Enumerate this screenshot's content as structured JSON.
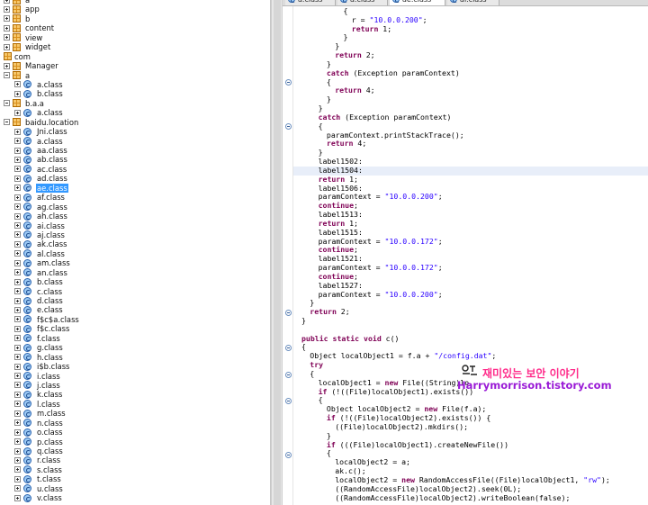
{
  "tree": {
    "items": [
      {
        "label": "a",
        "depth": 0,
        "kind": "pkg",
        "exp": "plus"
      },
      {
        "label": "app",
        "depth": 0,
        "kind": "pkg",
        "exp": "plus"
      },
      {
        "label": "b",
        "depth": 0,
        "kind": "pkg",
        "exp": "plus"
      },
      {
        "label": "content",
        "depth": 0,
        "kind": "pkg",
        "exp": "plus"
      },
      {
        "label": "view",
        "depth": 0,
        "kind": "pkg",
        "exp": "plus"
      },
      {
        "label": "widget",
        "depth": 0,
        "kind": "pkg",
        "exp": "plus"
      },
      {
        "label": "com",
        "depth": -1,
        "kind": "pkg",
        "exp": "none"
      },
      {
        "label": "Manager",
        "depth": 0,
        "kind": "pkg",
        "exp": "plus"
      },
      {
        "label": "a",
        "depth": 0,
        "kind": "pkg",
        "exp": "minus"
      },
      {
        "label": "a.class",
        "depth": 1,
        "kind": "cls",
        "exp": "plus"
      },
      {
        "label": "b.class",
        "depth": 1,
        "kind": "cls",
        "exp": "plus"
      },
      {
        "label": "b.a.a",
        "depth": 0,
        "kind": "pkg",
        "exp": "minus"
      },
      {
        "label": "a.class",
        "depth": 1,
        "kind": "cls",
        "exp": "plus"
      },
      {
        "label": "baidu.location",
        "depth": 0,
        "kind": "pkg",
        "exp": "minus"
      },
      {
        "label": "Jni.class",
        "depth": 1,
        "kind": "cls",
        "exp": "plus"
      },
      {
        "label": "a.class",
        "depth": 1,
        "kind": "cls",
        "exp": "plus"
      },
      {
        "label": "aa.class",
        "depth": 1,
        "kind": "cls",
        "exp": "plus"
      },
      {
        "label": "ab.class",
        "depth": 1,
        "kind": "cls",
        "exp": "plus"
      },
      {
        "label": "ac.class",
        "depth": 1,
        "kind": "cls",
        "exp": "plus"
      },
      {
        "label": "ad.class",
        "depth": 1,
        "kind": "cls",
        "exp": "plus"
      },
      {
        "label": "ae.class",
        "depth": 1,
        "kind": "cls",
        "exp": "plus",
        "selected": true
      },
      {
        "label": "af.class",
        "depth": 1,
        "kind": "cls",
        "exp": "plus"
      },
      {
        "label": "ag.class",
        "depth": 1,
        "kind": "cls",
        "exp": "plus"
      },
      {
        "label": "ah.class",
        "depth": 1,
        "kind": "cls",
        "exp": "plus"
      },
      {
        "label": "ai.class",
        "depth": 1,
        "kind": "cls",
        "exp": "plus"
      },
      {
        "label": "aj.class",
        "depth": 1,
        "kind": "cls",
        "exp": "plus"
      },
      {
        "label": "ak.class",
        "depth": 1,
        "kind": "cls",
        "exp": "plus"
      },
      {
        "label": "al.class",
        "depth": 1,
        "kind": "cls",
        "exp": "plus"
      },
      {
        "label": "am.class",
        "depth": 1,
        "kind": "cls",
        "exp": "plus"
      },
      {
        "label": "an.class",
        "depth": 1,
        "kind": "cls",
        "exp": "plus"
      },
      {
        "label": "b.class",
        "depth": 1,
        "kind": "cls",
        "exp": "plus"
      },
      {
        "label": "c.class",
        "depth": 1,
        "kind": "cls",
        "exp": "plus"
      },
      {
        "label": "d.class",
        "depth": 1,
        "kind": "cls",
        "exp": "plus"
      },
      {
        "label": "e.class",
        "depth": 1,
        "kind": "cls",
        "exp": "plus"
      },
      {
        "label": "f$c$a.class",
        "depth": 1,
        "kind": "cls",
        "exp": "plus"
      },
      {
        "label": "f$c.class",
        "depth": 1,
        "kind": "cls",
        "exp": "plus"
      },
      {
        "label": "f.class",
        "depth": 1,
        "kind": "cls",
        "exp": "plus"
      },
      {
        "label": "g.class",
        "depth": 1,
        "kind": "cls",
        "exp": "plus"
      },
      {
        "label": "h.class",
        "depth": 1,
        "kind": "cls",
        "exp": "plus"
      },
      {
        "label": "i$b.class",
        "depth": 1,
        "kind": "cls",
        "exp": "plus"
      },
      {
        "label": "i.class",
        "depth": 1,
        "kind": "cls",
        "exp": "plus"
      },
      {
        "label": "j.class",
        "depth": 1,
        "kind": "cls",
        "exp": "plus"
      },
      {
        "label": "k.class",
        "depth": 1,
        "kind": "cls",
        "exp": "plus"
      },
      {
        "label": "l.class",
        "depth": 1,
        "kind": "cls",
        "exp": "plus"
      },
      {
        "label": "m.class",
        "depth": 1,
        "kind": "cls",
        "exp": "plus"
      },
      {
        "label": "n.class",
        "depth": 1,
        "kind": "cls",
        "exp": "plus"
      },
      {
        "label": "o.class",
        "depth": 1,
        "kind": "cls",
        "exp": "plus"
      },
      {
        "label": "p.class",
        "depth": 1,
        "kind": "cls",
        "exp": "plus"
      },
      {
        "label": "q.class",
        "depth": 1,
        "kind": "cls",
        "exp": "plus"
      },
      {
        "label": "r.class",
        "depth": 1,
        "kind": "cls",
        "exp": "plus"
      },
      {
        "label": "s.class",
        "depth": 1,
        "kind": "cls",
        "exp": "plus"
      },
      {
        "label": "t.class",
        "depth": 1,
        "kind": "cls",
        "exp": "plus"
      },
      {
        "label": "u.class",
        "depth": 1,
        "kind": "cls",
        "exp": "plus"
      },
      {
        "label": "v.class",
        "depth": 1,
        "kind": "cls",
        "exp": "plus"
      }
    ]
  },
  "editor": {
    "tabs": [
      {
        "label": "a.class",
        "active": false
      },
      {
        "label": "a.class",
        "active": false
      },
      {
        "label": "ae.class",
        "active": true
      },
      {
        "label": "af.class",
        "active": false
      }
    ],
    "highlight_line": 18,
    "lines": [
      {
        "indent": 5,
        "text": "{"
      },
      {
        "indent": 6,
        "text": "r = \"10.0.0.200\";"
      },
      {
        "indent": 6,
        "text": "return 1;"
      },
      {
        "indent": 5,
        "text": "}"
      },
      {
        "indent": 4,
        "text": "}"
      },
      {
        "indent": 4,
        "text": "return 2;"
      },
      {
        "indent": 3,
        "text": "}"
      },
      {
        "indent": 3,
        "text": "catch (Exception paramContext)"
      },
      {
        "indent": 3,
        "text": "{"
      },
      {
        "indent": 4,
        "text": "return 4;"
      },
      {
        "indent": 3,
        "text": "}"
      },
      {
        "indent": 2,
        "text": "}"
      },
      {
        "indent": 2,
        "text": "catch (Exception paramContext)"
      },
      {
        "indent": 2,
        "text": "{"
      },
      {
        "indent": 3,
        "text": "paramContext.printStackTrace();"
      },
      {
        "indent": 3,
        "text": "return 4;"
      },
      {
        "indent": 2,
        "text": "}"
      },
      {
        "indent": 2,
        "text": "label1502:"
      },
      {
        "indent": 2,
        "text": "label1504:"
      },
      {
        "indent": 2,
        "text": "return 1;"
      },
      {
        "indent": 2,
        "text": "label1506:"
      },
      {
        "indent": 2,
        "text": "paramContext = \"10.0.0.200\";"
      },
      {
        "indent": 2,
        "text": "continue;"
      },
      {
        "indent": 2,
        "text": "label1513:"
      },
      {
        "indent": 2,
        "text": "return 1;"
      },
      {
        "indent": 2,
        "text": "label1515:"
      },
      {
        "indent": 2,
        "text": "paramContext = \"10.0.0.172\";"
      },
      {
        "indent": 2,
        "text": "continue;"
      },
      {
        "indent": 2,
        "text": "label1521:"
      },
      {
        "indent": 2,
        "text": "paramContext = \"10.0.0.172\";"
      },
      {
        "indent": 2,
        "text": "continue;"
      },
      {
        "indent": 2,
        "text": "label1527:"
      },
      {
        "indent": 2,
        "text": "paramContext = \"10.0.0.200\";"
      },
      {
        "indent": 1,
        "text": "}"
      },
      {
        "indent": 1,
        "text": "return 2;"
      },
      {
        "indent": 0,
        "text": "}"
      },
      {
        "indent": 0,
        "text": ""
      },
      {
        "indent": 0,
        "text": "public static void c()"
      },
      {
        "indent": 0,
        "text": "{"
      },
      {
        "indent": 1,
        "text": "Object localObject1 = f.a + \"/config.dat\";"
      },
      {
        "indent": 1,
        "text": "try"
      },
      {
        "indent": 1,
        "text": "{"
      },
      {
        "indent": 2,
        "text": "localObject1 = new File((String)lo"
      },
      {
        "indent": 2,
        "text": "if (!((File)localObject1).exists())"
      },
      {
        "indent": 2,
        "text": "{"
      },
      {
        "indent": 3,
        "text": "Object localObject2 = new File(f.a);"
      },
      {
        "indent": 3,
        "text": "if (!((File)localObject2).exists()) {"
      },
      {
        "indent": 4,
        "text": "((File)localObject2).mkdirs();"
      },
      {
        "indent": 3,
        "text": "}"
      },
      {
        "indent": 3,
        "text": "if (((File)localObject1).createNewFile())"
      },
      {
        "indent": 3,
        "text": "{"
      },
      {
        "indent": 4,
        "text": "localObject2 = a;"
      },
      {
        "indent": 4,
        "text": "ak.c();"
      },
      {
        "indent": 4,
        "text": "localObject2 = new RandomAccessFile((File)localObject1, \"rw\");"
      },
      {
        "indent": 4,
        "text": "((RandomAccessFile)localObject2).seek(0L);"
      },
      {
        "indent": 4,
        "text": "((RandomAccessFile)localObject2).writeBoolean(false);"
      }
    ],
    "folds": [
      8,
      13,
      34,
      38,
      41,
      44,
      50
    ]
  },
  "watermark": {
    "top_text": "재미있는 보안 이야기",
    "bottom_text": "Harrymorrison.tistory.com"
  },
  "colors": {
    "selection": "#3399ff",
    "keyword": "#7f0055",
    "string": "#2a00ff",
    "watermark_pink": "#ff2b8a",
    "watermark_purple": "#9a1bd6"
  }
}
